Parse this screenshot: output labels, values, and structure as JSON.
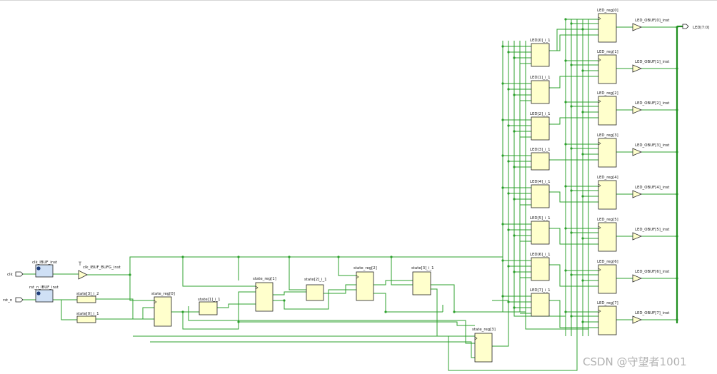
{
  "ports": {
    "clk": "clk",
    "rst_n": "rst_n",
    "led_bus": "LED[7:0]"
  },
  "cells": {
    "clk_ibuf": "clk_IBUF_inst",
    "rst_ibuf": "rst_n_IBUF_inst",
    "clk_bufg": "clk_IBUF_BUFG_inst",
    "state3_i2": "state[3]_i_2",
    "state0_i1": "state[0]_i_1",
    "state_reg0": "state_reg[0]",
    "state1_i1": "state[1]_i_1",
    "state_reg1": "state_reg[1]",
    "state2_i1": "state[2]_i_1",
    "state_reg2": "state_reg[2]",
    "state3_i1": "state[3]_i_1",
    "state_reg3": "state_reg[3]"
  },
  "led_logic": [
    "LED[0]_i_1",
    "LED[1]_i_1",
    "LED[2]_i_1",
    "LED[3]_i_1",
    "LED[4]_i_1",
    "LED[5]_i_1",
    "LED[6]_i_1",
    "LED[7]_i_1"
  ],
  "led_regs": [
    "LED_reg[0]",
    "LED_reg[1]",
    "LED_reg[2]",
    "LED_reg[3]",
    "LED_reg[4]",
    "LED_reg[5]",
    "LED_reg[6]",
    "LED_reg[7]"
  ],
  "led_obufs": [
    "LED_OBUF[0]_inst",
    "LED_OBUF[1]_inst",
    "LED_OBUF[2]_inst",
    "LED_OBUF[3]_inst",
    "LED_OBUF[4]_inst",
    "LED_OBUF[5]_inst",
    "LED_OBUF[6]_inst",
    "LED_OBUF[7]_inst"
  ],
  "watermark": "CSDN @守望者1001",
  "colors": {
    "wire": "#2ca02c",
    "bus": "#1f8f1f",
    "cell_fill": "#ffffcc",
    "ibuf_fill": "#cfe0f5",
    "cell_stroke": "#222222"
  }
}
